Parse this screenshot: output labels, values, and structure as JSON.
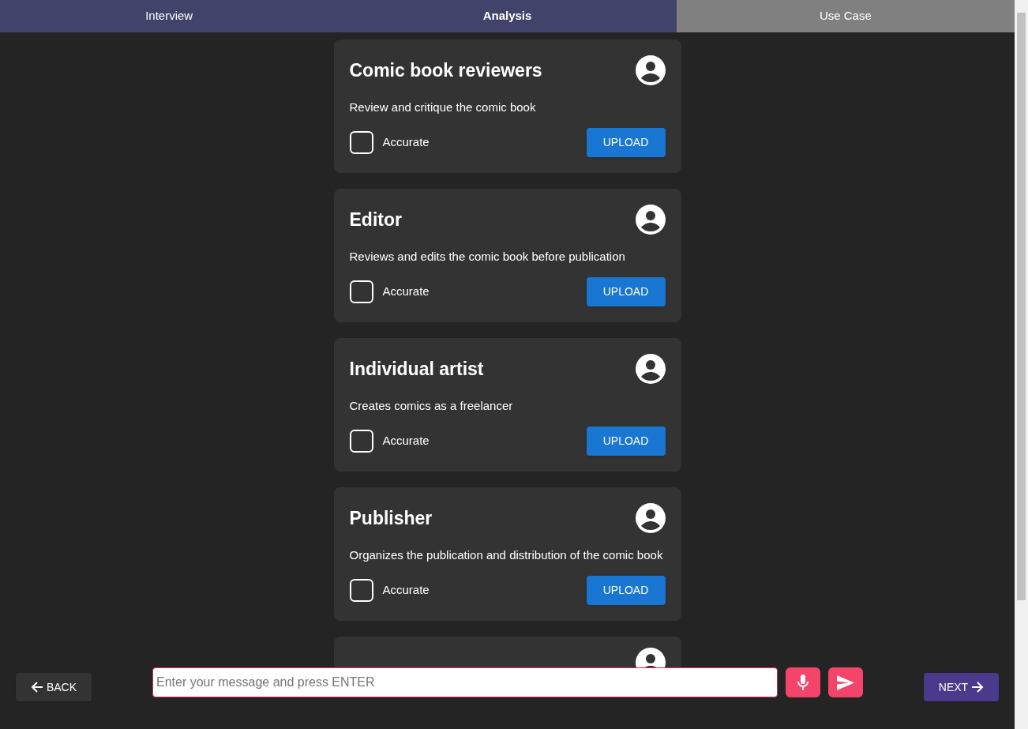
{
  "tabs": [
    {
      "label": "Interview",
      "selected": false,
      "disabled": false
    },
    {
      "label": "Analysis",
      "selected": true,
      "disabled": false
    },
    {
      "label": "Use Case",
      "selected": false,
      "disabled": true
    }
  ],
  "cards": [
    {
      "title": "Comic book reviewers",
      "description": "Review and critique the comic book",
      "checkbox_label": "Accurate",
      "checked": false,
      "button": "UPLOAD"
    },
    {
      "title": "Editor",
      "description": "Reviews and edits the comic book before publication",
      "checkbox_label": "Accurate",
      "checked": false,
      "button": "UPLOAD"
    },
    {
      "title": "Individual artist",
      "description": "Creates comics as a freelancer",
      "checkbox_label": "Accurate",
      "checked": false,
      "button": "UPLOAD"
    },
    {
      "title": "Publisher",
      "description": "Organizes the publication and distribution of the comic book",
      "checkbox_label": "Accurate",
      "checked": false,
      "button": "UPLOAD"
    }
  ],
  "more_cards_below": true,
  "bottom_bar": {
    "back": "BACK",
    "message": {
      "placeholder": "Enter your message and press ENTER"
    },
    "next": "NEXT"
  }
}
